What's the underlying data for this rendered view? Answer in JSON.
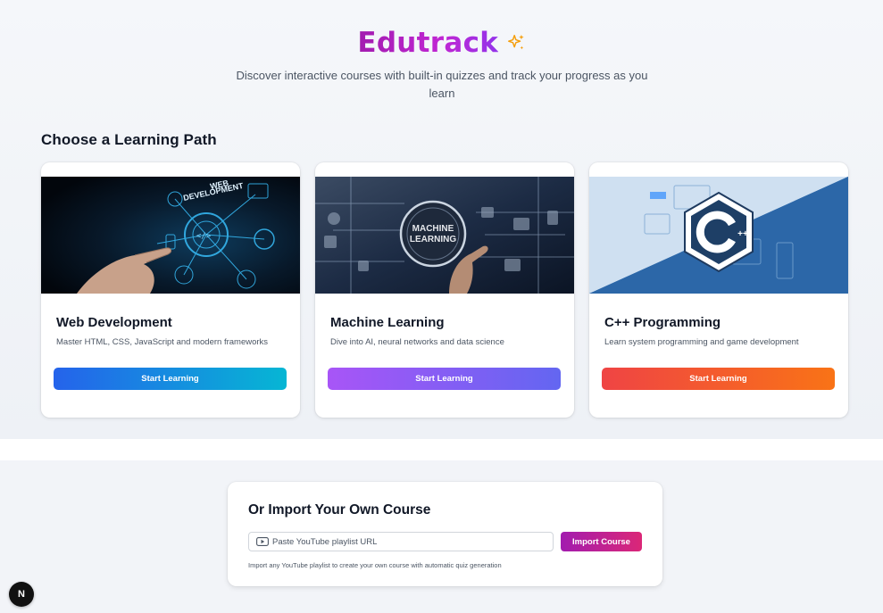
{
  "app": {
    "title": "Edutrack",
    "subtitle": "Discover interactive courses with built-in quizzes and track your progress as you learn"
  },
  "paths": {
    "heading": "Choose a Learning Path",
    "courses": [
      {
        "title": "Web Development",
        "description": "Master HTML, CSS, JavaScript and modern frameworks",
        "button": "Start Learning",
        "image_icon": "web-development-banner",
        "image_text": "WEB DEVELOPMENT",
        "colors": [
          "#2563eb",
          "#06b6d4"
        ]
      },
      {
        "title": "Machine Learning",
        "description": "Dive into AI, neural networks and data science",
        "button": "Start Learning",
        "image_icon": "machine-learning-banner",
        "image_text": "MACHINE LEARNING",
        "colors": [
          "#a855f7",
          "#6366f1"
        ]
      },
      {
        "title": "C++ Programming",
        "description": "Learn system programming and game development",
        "button": "Start Learning",
        "image_icon": "cpp-logo-banner",
        "image_text": "C++",
        "colors": [
          "#ef4444",
          "#f97316"
        ]
      }
    ]
  },
  "import": {
    "title": "Or Import Your Own Course",
    "placeholder": "Paste YouTube playlist URL",
    "button": "Import Course",
    "hint": "Import any YouTube playlist to create your own course with automatic quiz generation"
  },
  "badge": {
    "label": "N"
  },
  "colors": {
    "accent": "#c026d3",
    "sparkle": "#f59e0b"
  }
}
